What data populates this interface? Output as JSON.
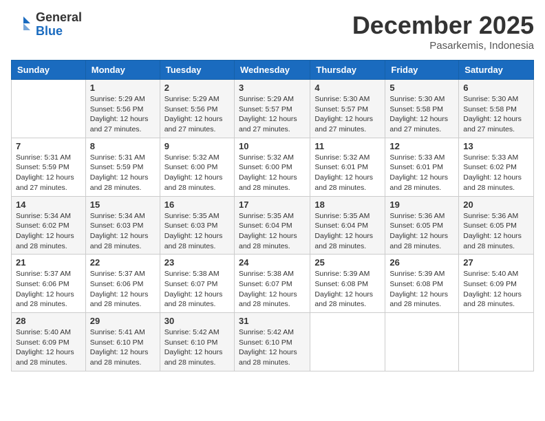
{
  "header": {
    "logo_general": "General",
    "logo_blue": "Blue",
    "month": "December 2025",
    "location": "Pasarkemis, Indonesia"
  },
  "weekdays": [
    "Sunday",
    "Monday",
    "Tuesday",
    "Wednesday",
    "Thursday",
    "Friday",
    "Saturday"
  ],
  "rows": [
    [
      {
        "day": "",
        "sunrise": "",
        "sunset": "",
        "daylight": ""
      },
      {
        "day": "1",
        "sunrise": "Sunrise: 5:29 AM",
        "sunset": "Sunset: 5:56 PM",
        "daylight": "Daylight: 12 hours and 27 minutes."
      },
      {
        "day": "2",
        "sunrise": "Sunrise: 5:29 AM",
        "sunset": "Sunset: 5:56 PM",
        "daylight": "Daylight: 12 hours and 27 minutes."
      },
      {
        "day": "3",
        "sunrise": "Sunrise: 5:29 AM",
        "sunset": "Sunset: 5:57 PM",
        "daylight": "Daylight: 12 hours and 27 minutes."
      },
      {
        "day": "4",
        "sunrise": "Sunrise: 5:30 AM",
        "sunset": "Sunset: 5:57 PM",
        "daylight": "Daylight: 12 hours and 27 minutes."
      },
      {
        "day": "5",
        "sunrise": "Sunrise: 5:30 AM",
        "sunset": "Sunset: 5:58 PM",
        "daylight": "Daylight: 12 hours and 27 minutes."
      },
      {
        "day": "6",
        "sunrise": "Sunrise: 5:30 AM",
        "sunset": "Sunset: 5:58 PM",
        "daylight": "Daylight: 12 hours and 27 minutes."
      }
    ],
    [
      {
        "day": "7",
        "sunrise": "Sunrise: 5:31 AM",
        "sunset": "Sunset: 5:59 PM",
        "daylight": "Daylight: 12 hours and 27 minutes."
      },
      {
        "day": "8",
        "sunrise": "Sunrise: 5:31 AM",
        "sunset": "Sunset: 5:59 PM",
        "daylight": "Daylight: 12 hours and 28 minutes."
      },
      {
        "day": "9",
        "sunrise": "Sunrise: 5:32 AM",
        "sunset": "Sunset: 6:00 PM",
        "daylight": "Daylight: 12 hours and 28 minutes."
      },
      {
        "day": "10",
        "sunrise": "Sunrise: 5:32 AM",
        "sunset": "Sunset: 6:00 PM",
        "daylight": "Daylight: 12 hours and 28 minutes."
      },
      {
        "day": "11",
        "sunrise": "Sunrise: 5:32 AM",
        "sunset": "Sunset: 6:01 PM",
        "daylight": "Daylight: 12 hours and 28 minutes."
      },
      {
        "day": "12",
        "sunrise": "Sunrise: 5:33 AM",
        "sunset": "Sunset: 6:01 PM",
        "daylight": "Daylight: 12 hours and 28 minutes."
      },
      {
        "day": "13",
        "sunrise": "Sunrise: 5:33 AM",
        "sunset": "Sunset: 6:02 PM",
        "daylight": "Daylight: 12 hours and 28 minutes."
      }
    ],
    [
      {
        "day": "14",
        "sunrise": "Sunrise: 5:34 AM",
        "sunset": "Sunset: 6:02 PM",
        "daylight": "Daylight: 12 hours and 28 minutes."
      },
      {
        "day": "15",
        "sunrise": "Sunrise: 5:34 AM",
        "sunset": "Sunset: 6:03 PM",
        "daylight": "Daylight: 12 hours and 28 minutes."
      },
      {
        "day": "16",
        "sunrise": "Sunrise: 5:35 AM",
        "sunset": "Sunset: 6:03 PM",
        "daylight": "Daylight: 12 hours and 28 minutes."
      },
      {
        "day": "17",
        "sunrise": "Sunrise: 5:35 AM",
        "sunset": "Sunset: 6:04 PM",
        "daylight": "Daylight: 12 hours and 28 minutes."
      },
      {
        "day": "18",
        "sunrise": "Sunrise: 5:35 AM",
        "sunset": "Sunset: 6:04 PM",
        "daylight": "Daylight: 12 hours and 28 minutes."
      },
      {
        "day": "19",
        "sunrise": "Sunrise: 5:36 AM",
        "sunset": "Sunset: 6:05 PM",
        "daylight": "Daylight: 12 hours and 28 minutes."
      },
      {
        "day": "20",
        "sunrise": "Sunrise: 5:36 AM",
        "sunset": "Sunset: 6:05 PM",
        "daylight": "Daylight: 12 hours and 28 minutes."
      }
    ],
    [
      {
        "day": "21",
        "sunrise": "Sunrise: 5:37 AM",
        "sunset": "Sunset: 6:06 PM",
        "daylight": "Daylight: 12 hours and 28 minutes."
      },
      {
        "day": "22",
        "sunrise": "Sunrise: 5:37 AM",
        "sunset": "Sunset: 6:06 PM",
        "daylight": "Daylight: 12 hours and 28 minutes."
      },
      {
        "day": "23",
        "sunrise": "Sunrise: 5:38 AM",
        "sunset": "Sunset: 6:07 PM",
        "daylight": "Daylight: 12 hours and 28 minutes."
      },
      {
        "day": "24",
        "sunrise": "Sunrise: 5:38 AM",
        "sunset": "Sunset: 6:07 PM",
        "daylight": "Daylight: 12 hours and 28 minutes."
      },
      {
        "day": "25",
        "sunrise": "Sunrise: 5:39 AM",
        "sunset": "Sunset: 6:08 PM",
        "daylight": "Daylight: 12 hours and 28 minutes."
      },
      {
        "day": "26",
        "sunrise": "Sunrise: 5:39 AM",
        "sunset": "Sunset: 6:08 PM",
        "daylight": "Daylight: 12 hours and 28 minutes."
      },
      {
        "day": "27",
        "sunrise": "Sunrise: 5:40 AM",
        "sunset": "Sunset: 6:09 PM",
        "daylight": "Daylight: 12 hours and 28 minutes."
      }
    ],
    [
      {
        "day": "28",
        "sunrise": "Sunrise: 5:40 AM",
        "sunset": "Sunset: 6:09 PM",
        "daylight": "Daylight: 12 hours and 28 minutes."
      },
      {
        "day": "29",
        "sunrise": "Sunrise: 5:41 AM",
        "sunset": "Sunset: 6:10 PM",
        "daylight": "Daylight: 12 hours and 28 minutes."
      },
      {
        "day": "30",
        "sunrise": "Sunrise: 5:42 AM",
        "sunset": "Sunset: 6:10 PM",
        "daylight": "Daylight: 12 hours and 28 minutes."
      },
      {
        "day": "31",
        "sunrise": "Sunrise: 5:42 AM",
        "sunset": "Sunset: 6:10 PM",
        "daylight": "Daylight: 12 hours and 28 minutes."
      },
      {
        "day": "",
        "sunrise": "",
        "sunset": "",
        "daylight": ""
      },
      {
        "day": "",
        "sunrise": "",
        "sunset": "",
        "daylight": ""
      },
      {
        "day": "",
        "sunrise": "",
        "sunset": "",
        "daylight": ""
      }
    ]
  ]
}
